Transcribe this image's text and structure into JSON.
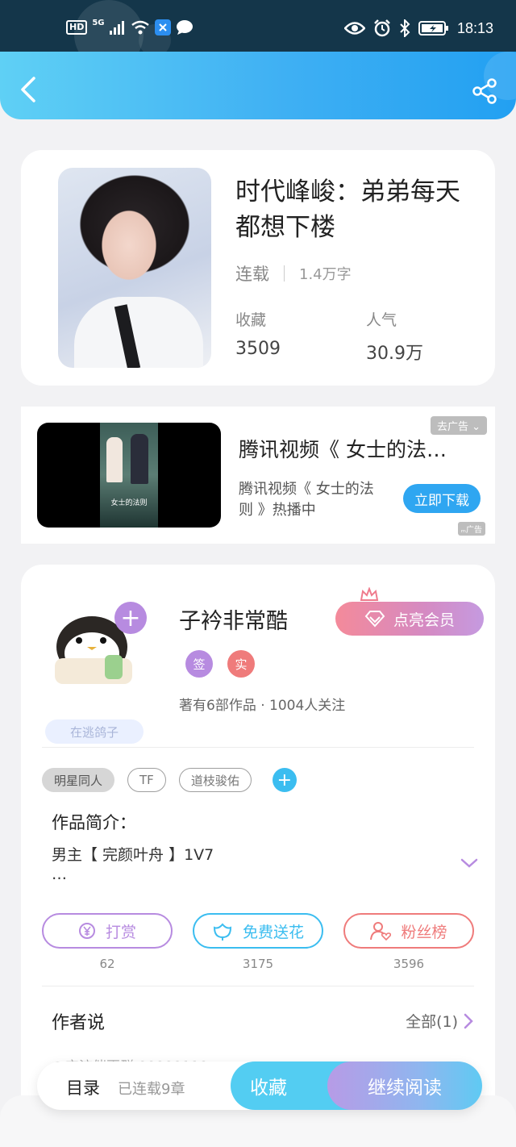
{
  "status_bar": {
    "hd": "HD",
    "network": "5G",
    "time": "18:13"
  },
  "header": {
    "back_icon": "chevron-left-icon",
    "share_icon": "share-icon"
  },
  "book": {
    "title": "时代峰峻：弟弟每天都想下楼",
    "status": "连载",
    "word_count": "1.4万字",
    "favorites_label": "收藏",
    "favorites_value": "3509",
    "popularity_label": "人气",
    "popularity_value": "30.9万"
  },
  "ad": {
    "close_label": "去广告",
    "title": "腾讯视频《 女士的法…",
    "description": "腾讯视频《 女士的法则 》热播中",
    "download_label": "立即下载",
    "ad_tag": "广告",
    "poster_text": "女士的法则"
  },
  "author": {
    "name": "子衿非常酷",
    "vip_label": "点亮会员",
    "badge_sign": "签",
    "badge_real": "实",
    "meta": "著有6部作品 · 1004人关注",
    "dove_tag": "在逃鸽子",
    "tags": [
      "明星同人",
      "TF",
      "道枝骏佑"
    ],
    "intro_title": "作品简介：",
    "intro_text": "男主【 完颜叶舟 】1V7",
    "intro_more": "…",
    "actions": [
      {
        "label": "打赏",
        "count": "62",
        "color": "#b78be0",
        "icon": "yen-icon"
      },
      {
        "label": "免费送花",
        "count": "3175",
        "color": "#3bbdf0",
        "icon": "flower-icon"
      },
      {
        "label": "粉丝榜",
        "count": "3596",
        "color": "#ef7b7b",
        "icon": "fans-icon"
      }
    ],
    "says_title": "作者说",
    "see_all": "全部(1)",
    "says_preview": "@宝流催更群 00000110"
  },
  "bottom_bar": {
    "toc_label": "目录",
    "chapters": "已连载9章",
    "favorite_label": "收藏",
    "continue_label": "继续阅读"
  }
}
